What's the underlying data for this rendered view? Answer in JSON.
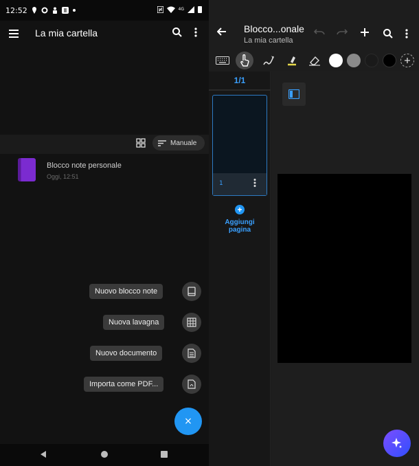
{
  "status_bar": {
    "time": "12:52",
    "network": "4G"
  },
  "left": {
    "title": "La mia cartella",
    "sort_label": "Manuale",
    "notebook": {
      "title": "Blocco note personale",
      "date": "Oggi, 12:51",
      "color": "#7b2bd0"
    },
    "fab_menu": [
      {
        "label": "Nuovo blocco note",
        "icon": "notebook-icon"
      },
      {
        "label": "Nuova lavagna",
        "icon": "grid-board-icon"
      },
      {
        "label": "Nuovo documento",
        "icon": "document-icon"
      },
      {
        "label": "Importa come PDF...",
        "icon": "pdf-icon"
      }
    ],
    "fab_close": "×",
    "accent": "#2196f3"
  },
  "right": {
    "title": "Blocco...onale",
    "subtitle": "La mia cartella",
    "page_count": "1/1",
    "page_number": "1",
    "add_page": "Aggiungi pagina",
    "add_page_lines": [
      "Aggiungi",
      "pagina"
    ],
    "swatches": [
      "#ffffff",
      "#8a8a8a",
      "#1a1a1a",
      "#000000"
    ],
    "accent": "#3aa0ff"
  }
}
